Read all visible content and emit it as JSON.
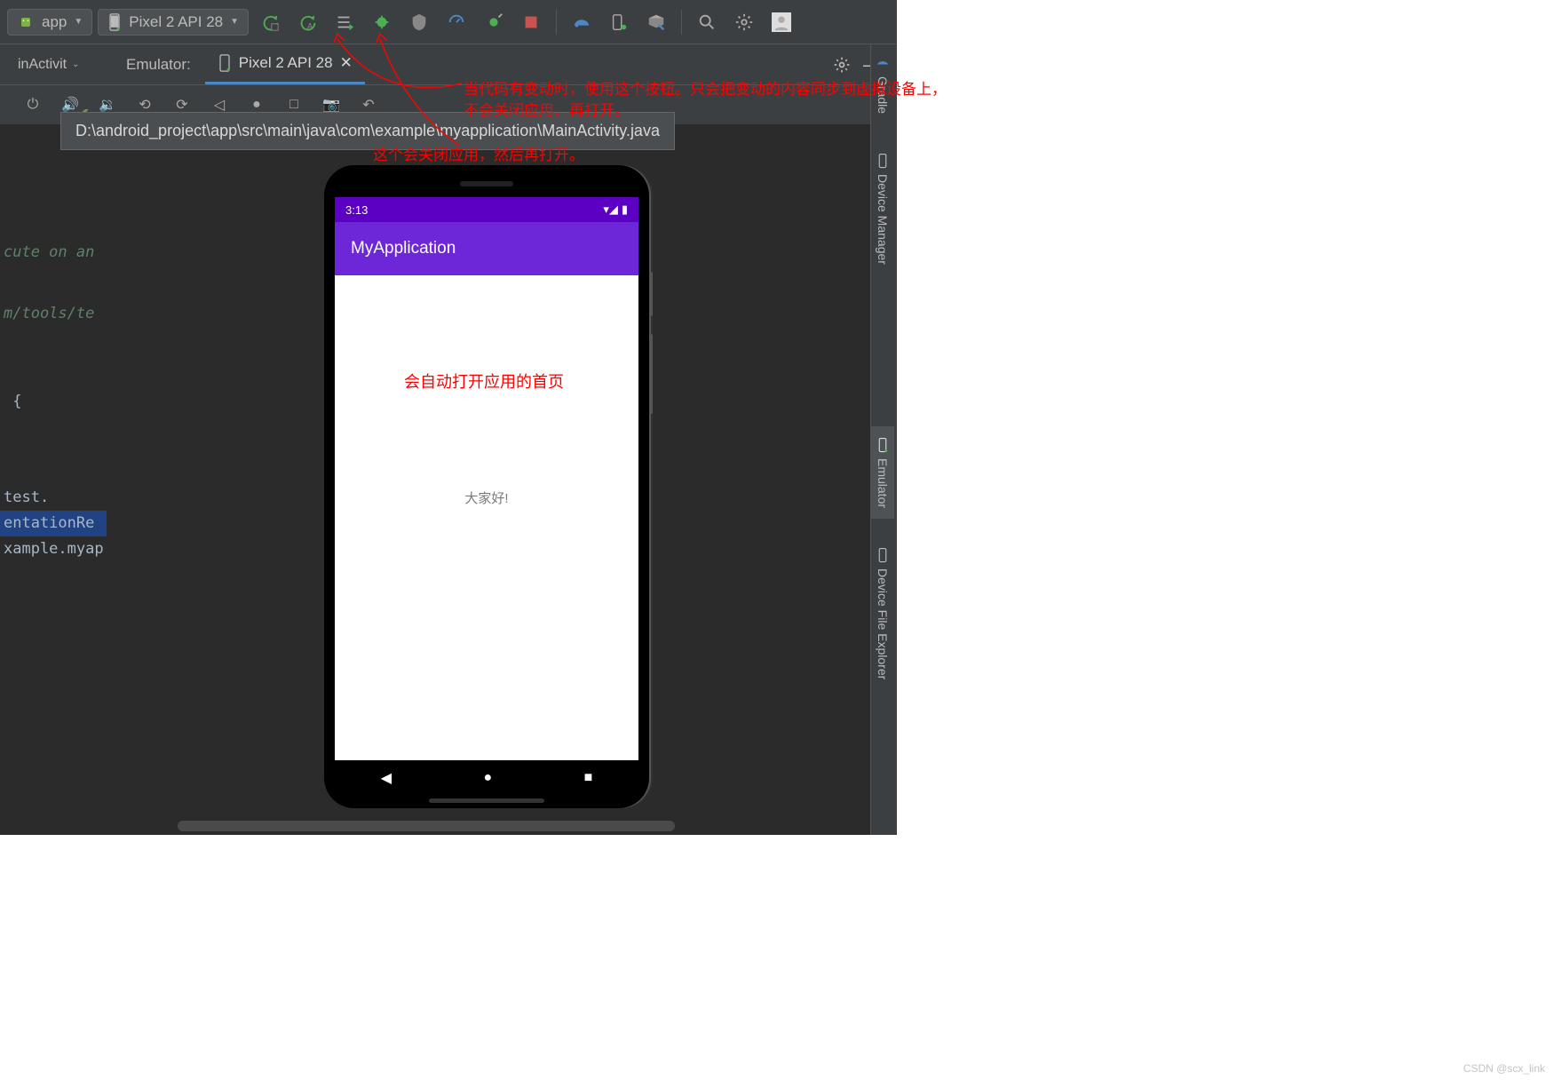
{
  "toolbar": {
    "app_dropdown": "app",
    "device_dropdown": "Pixel 2 API 28"
  },
  "editor": {
    "truncated_tab": "inActivit",
    "emulator_label": "Emulator:",
    "active_tab": "Pixel 2 API 28"
  },
  "tooltip": {
    "path": "D:\\android_project\\app\\src\\main\\java\\com\\example\\myapplication\\MainActivity.java"
  },
  "code": {
    "line1": "cute on an",
    "line2": "m/tools/te",
    "line3": " {",
    "line4": "test.",
    "line5": "entationRe",
    "line6": "xample.myap"
  },
  "phone": {
    "time": "3:13",
    "app_title": "MyApplication",
    "body_text": "大家好!"
  },
  "annotations": {
    "top1": "当代码有变动时，使用这个按钮。只会把变动的内容同步到虚拟设备上，",
    "top2": "不会关闭应用、再打开。",
    "mid": "这个会关闭应用，然后再打开。",
    "phone_note": "会自动打开应用的首页"
  },
  "side_rail": {
    "gradle": "Gradle",
    "device_manager": "Device Manager",
    "emulator": "Emulator",
    "device_file_explorer": "Device File Explorer"
  },
  "watermark": "CSDN @scx_link"
}
